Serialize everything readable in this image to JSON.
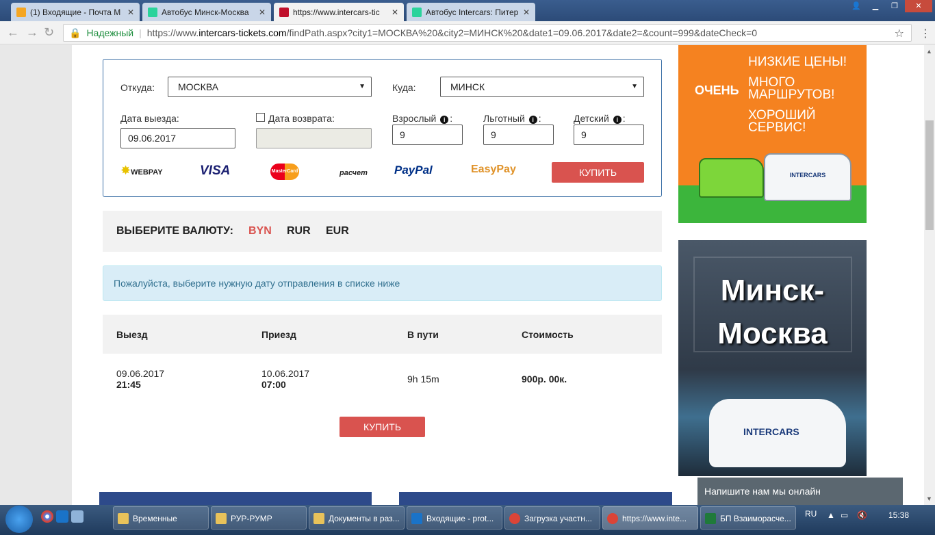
{
  "browser": {
    "tabs": [
      {
        "title": "(1) Входящие - Почта M",
        "active": false,
        "icon_color": "#f5a623"
      },
      {
        "title": "Автобус Минск-Москва",
        "active": false,
        "icon_color": "#2bd39b"
      },
      {
        "title": "https://www.intercars-tic",
        "active": true,
        "icon_color": "#c0102b"
      },
      {
        "title": "Автобус Intercars: Питер",
        "active": false,
        "icon_color": "#2bd39b"
      }
    ],
    "secure_label": "Надежный",
    "url_prefix": "https://www.",
    "url_host": "intercars-tickets.com",
    "url_path": "/findPath.aspx?city1=МОСКВА%20&city2=МИНСК%20&date1=09.06.2017&date2=&count=999&dateCheck=0"
  },
  "form": {
    "from_label": "Откуда:",
    "from_value": "МОСКВА",
    "to_label": "Куда:",
    "to_value": "МИНСК",
    "depart_label": "Дата выезда:",
    "depart_value": "09.06.2017",
    "return_label": "Дата возврата:",
    "return_value": "",
    "adult_label": "Взрослый",
    "adult_value": "9",
    "discount_label": "Льготный",
    "discount_value": "9",
    "child_label": "Детский",
    "child_value": "9",
    "colon": ":",
    "buy_label": "КУПИТЬ",
    "payment_logos": [
      "WEBPAY",
      "VISA",
      "MasterCard",
      "расчет",
      "PayPal",
      "EasyPay"
    ]
  },
  "currency": {
    "label": "ВЫБЕРИТЕ ВАЛЮТУ:",
    "options": [
      "BYN",
      "RUR",
      "EUR"
    ],
    "selected": "BYN"
  },
  "alert": "Пожалуйста, выберите нужную дату отправления в списке ниже",
  "table": {
    "headers": [
      "Выезд",
      "Приезд",
      "В пути",
      "Стоимость"
    ],
    "row": {
      "depart_date": "09.06.2017",
      "depart_time": "21:45",
      "arrive_date": "10.06.2017",
      "arrive_time": "07:00",
      "duration": "9h 15m",
      "price": "900р. 00к."
    },
    "buy_label": "КУПИТЬ"
  },
  "ads": {
    "ad1_very": "ОЧЕНЬ",
    "ad1_lines": [
      "НИЗКИЕ ЦЕНЫ!",
      "МНОГО",
      "МАРШРУТОВ!",
      "ХОРОШИЙ",
      "СЕРВИС!"
    ],
    "ad2_line1": "Минск-",
    "ad2_line2": "Москва",
    "bus_brand": "INTERCARS"
  },
  "chat": "Напишите нам мы онлайн",
  "taskbar": {
    "tasks": [
      {
        "label": "Временные",
        "color": "#e8c25a"
      },
      {
        "label": "РУР-РУМР",
        "color": "#e8c25a"
      },
      {
        "label": "Документы в раз...",
        "color": "#e8c25a"
      },
      {
        "label": "Входящие - prot...",
        "color": "#1a73c8"
      },
      {
        "label": "Загрузка участн...",
        "color": "#db4437"
      },
      {
        "label": "https://www.inte...",
        "color": "#db4437"
      },
      {
        "label": "БП Взаиморасче...",
        "color": "#1f7a3a"
      }
    ],
    "lang": "RU",
    "time": "15:38"
  }
}
